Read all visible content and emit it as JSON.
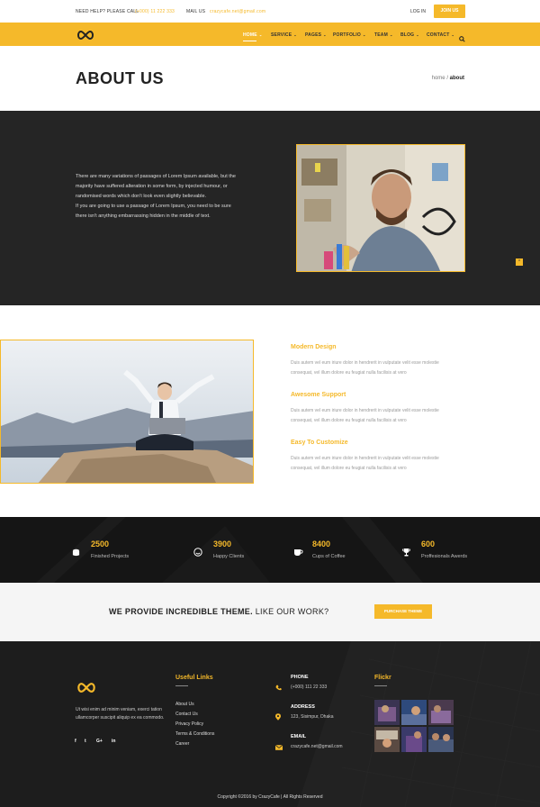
{
  "topbar": {
    "help_label": "NEED HELP? PLEASE CALL",
    "phone": "(+000) 11 222 333",
    "mail_label": "MAIL US",
    "email": "crazycafe.net@gmail.com",
    "login": "LOG IN",
    "join": "JOIN US"
  },
  "nav": {
    "items": [
      {
        "label": "HOME"
      },
      {
        "label": "SERVICE"
      },
      {
        "label": "PAGES"
      },
      {
        "label": "PORTFOLIO"
      },
      {
        "label": "TEAM"
      },
      {
        "label": "BLOG"
      },
      {
        "label": "CONTACT"
      }
    ],
    "caret": "⌄",
    "search_icon": "search-icon",
    "logo_icon": "infinity-logo-icon"
  },
  "header": {
    "title": "ABOUT US",
    "breadcrumb_home": "home",
    "breadcrumb_sep": "/",
    "breadcrumb_current": "about"
  },
  "intro": {
    "text1": "There are many variations of passages of Lorem Ipsum available, but the majority have suffered alteration in some form, by injected humour, or randomised words which don't look even slightly believable.",
    "text2": "If you are going to use a passage of Lorem Ipsum, you need to be sure there isn't anything embarrassing hidden in the middle of text.",
    "scroll_icon": "arrow-up-icon"
  },
  "features": [
    {
      "title": "Modern Design",
      "desc": "Duis autem vel eum iriure dolor in hendrerit in vulputate velit esse molestie consequat, vel illum dolore eu feugiat nulla facilisis at vero"
    },
    {
      "title": "Awesome Support",
      "desc": "Duis autem vel eum iriure dolor in hendrerit in vulputate velit esse molestie consequat, vel illum dolore eu feugiat nulla facilisis at vero"
    },
    {
      "title": "Easy To Customize",
      "desc": "Duis autem vel eum iriure dolor in hendrerit in vulputate velit esse molestie consequat, vel illum dolore eu feugiat nulla facilisis at vero"
    }
  ],
  "stats": [
    {
      "number": "2500",
      "label": "Finished Projects",
      "icon": "database-icon"
    },
    {
      "number": "3900",
      "label": "Happy Clients",
      "icon": "smile-icon"
    },
    {
      "number": "8400",
      "label": "Cups of Coffee",
      "icon": "coffee-cup-icon"
    },
    {
      "number": "600",
      "label": "Proffesionals Awerds",
      "icon": "trophy-icon"
    }
  ],
  "cta": {
    "bold": "WE PROVIDE INCREDIBLE THEME.",
    "rest": " LIKE OUR WORK?",
    "button": "PURCHASE THEME"
  },
  "footer": {
    "about": "Ut wisi enim ad minim veniam, exerci tation ullamcorper suscipit aliquip ex ea commodo.",
    "social": [
      "f",
      "t",
      "G+",
      "in"
    ],
    "links_title": "Useful Links",
    "links": [
      "About Us",
      "Contact Us",
      "Privacy Policy",
      "Terms & Conditions",
      "Career"
    ],
    "contact": [
      {
        "title": "PHONE",
        "value": "(+000) 111 22 333",
        "icon": "phone-icon"
      },
      {
        "title": "ADDRESS",
        "value": "123, Sisimpur, Dhaka",
        "icon": "map-pin-icon"
      },
      {
        "title": "EMAIL",
        "value": "crazycafe.net@gmail.com",
        "icon": "envelope-icon"
      }
    ],
    "flickr_title": "Flickr",
    "copyright": "Copyright ©2016 by CrazyCafe   |   All Rights Reserved"
  },
  "colors": {
    "accent": "#f5b92a",
    "dark": "#252525",
    "footer": "#1d1d1d"
  }
}
